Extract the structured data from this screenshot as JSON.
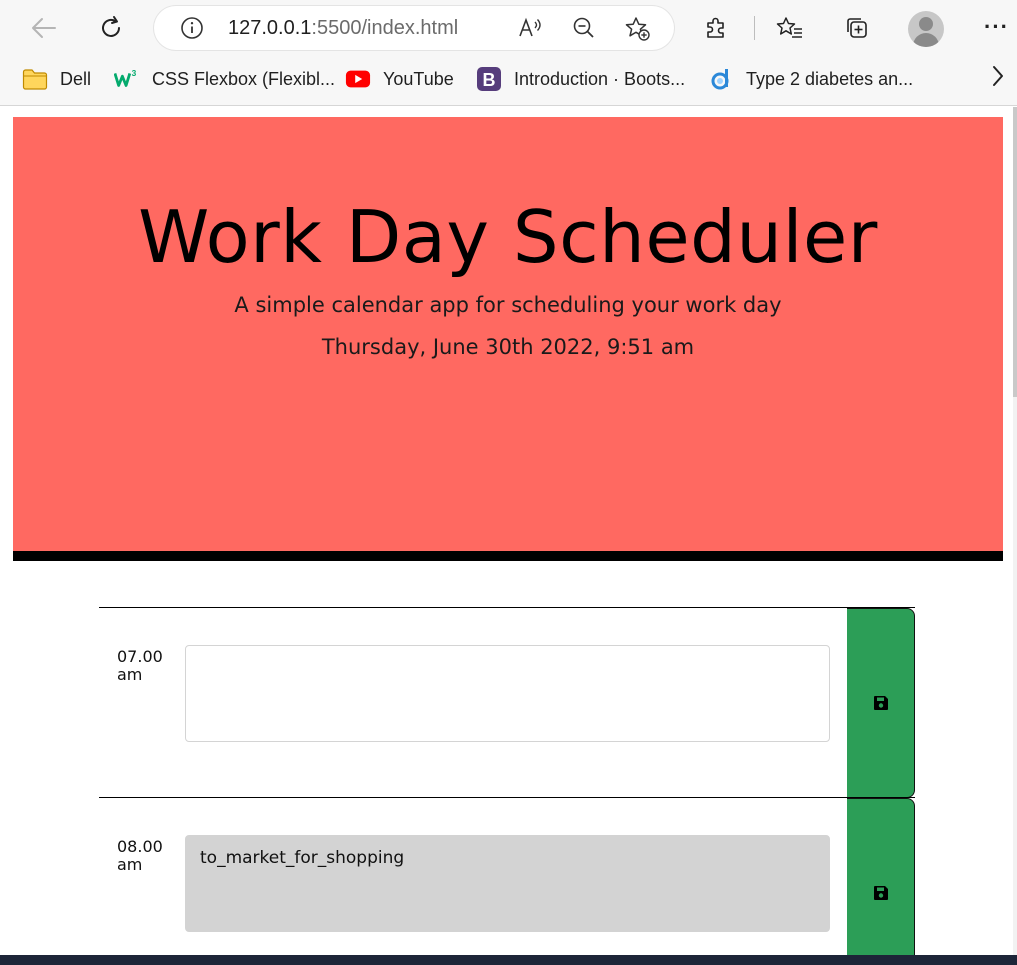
{
  "browser": {
    "url_host": "127.0.0.1",
    "url_rest": ":5500/index.html",
    "bookmarks": [
      {
        "label": "Dell",
        "icon": "folder-icon"
      },
      {
        "label": "CSS Flexbox (Flexibl...",
        "icon": "w3schools-icon"
      },
      {
        "label": "YouTube",
        "icon": "youtube-icon"
      },
      {
        "label": "Introduction · Boots...",
        "icon": "bootstrap-icon"
      },
      {
        "label": "Type 2 diabetes an...",
        "icon": "d-logo-icon"
      }
    ],
    "more_label": "···"
  },
  "header": {
    "title": "Work Day Scheduler",
    "lead": "A simple calendar app for scheduling your work day",
    "current_day": "Thursday, June 30th 2022, 9:51 am"
  },
  "timeblocks": [
    {
      "hour": "07.00 am",
      "text": "",
      "state": "past"
    },
    {
      "hour": "08.00 am",
      "text": "to_market_for_shopping",
      "state": "past"
    }
  ],
  "colors": {
    "jumbotron": "#ff6961",
    "save_button": "#2c9e57",
    "past_block": "#d3d3d3"
  }
}
